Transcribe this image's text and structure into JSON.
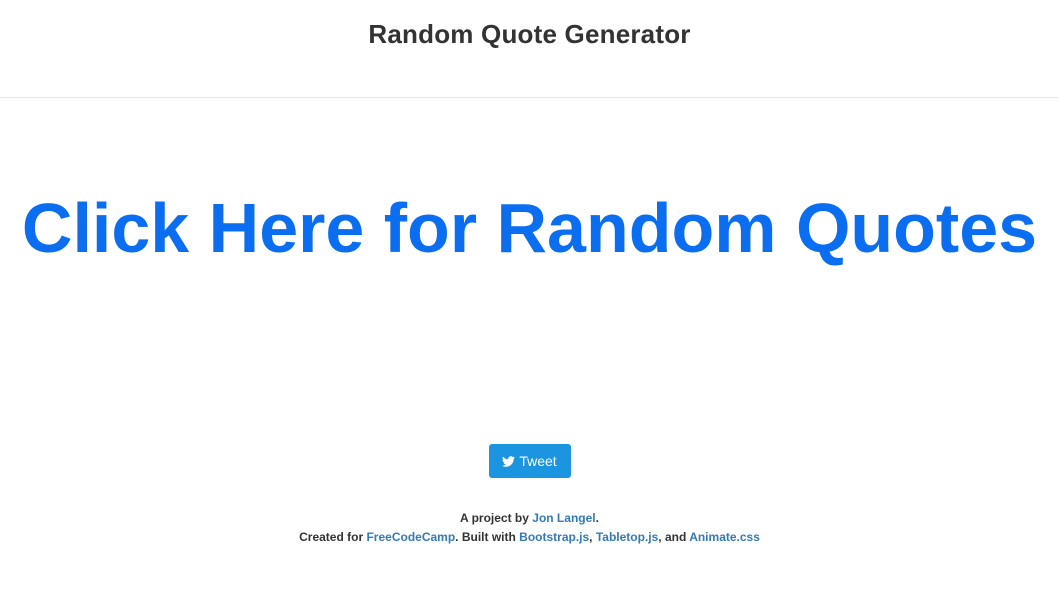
{
  "header": {
    "title": "Random Quote Generator"
  },
  "main": {
    "quote_link": "Click Here for Random Quotes",
    "tweet_label": "Tweet",
    "tweet_icon": "twitter-bird-icon"
  },
  "footer": {
    "line1_prefix": "A project by ",
    "author_link": "Jon Langel",
    "line1_suffix": ".",
    "line2_prefix": "Created for ",
    "fcc_link": "FreeCodeCamp",
    "line2_mid": ". Built with ",
    "bootstrap_link": "Bootstrap.js",
    "sep1": ", ",
    "tabletop_link": "Tabletop.js",
    "sep2": ", and ",
    "animate_link": "Animate.css"
  },
  "colors": {
    "header_text": "#333333",
    "quote_link": "#0b6ef0",
    "tweet_button": "#1b95e0",
    "footer_link": "#337ab7",
    "divider": "#e7e7e7"
  }
}
